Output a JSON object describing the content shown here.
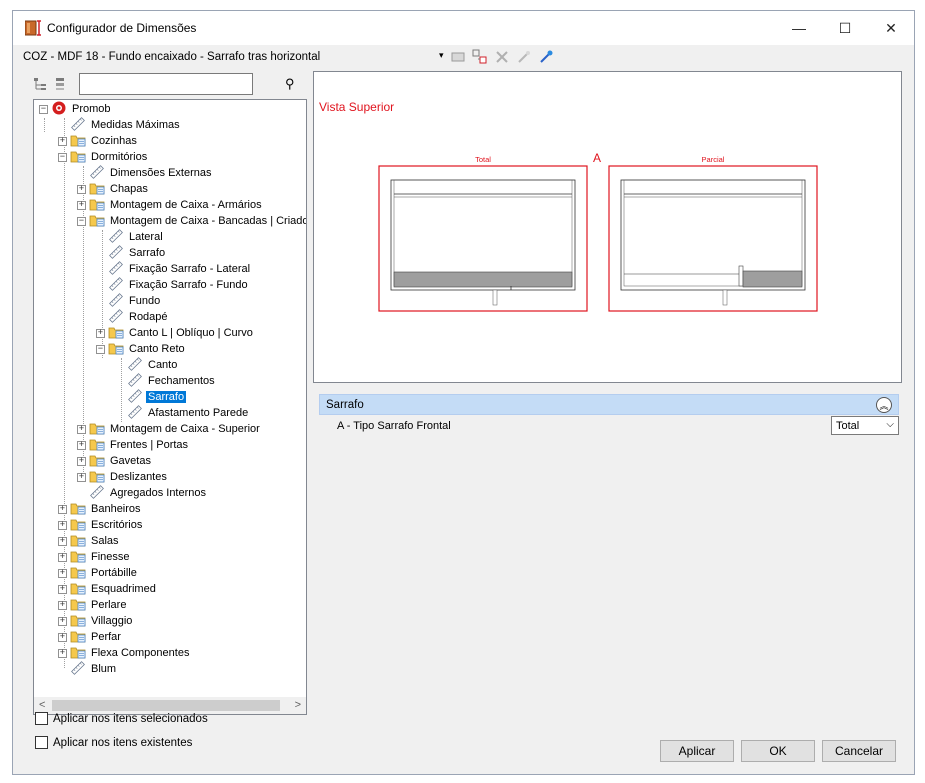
{
  "window": {
    "title": "Configurador de Dimensões",
    "minimize": "—",
    "maximize": "☐",
    "close": "✕"
  },
  "pathbar": {
    "path": "COZ - MDF 18 - Fundo encaixado - Sarrafo tras horizontal",
    "dropdown_glyph": "▾"
  },
  "tree": {
    "nodes": [
      {
        "label": "Promob",
        "depth": 0,
        "expand": "minus",
        "icon": "promob-logo-icon"
      },
      {
        "label": "Medidas Máximas",
        "depth": 1,
        "expand": "none",
        "icon": "ruler-icon"
      },
      {
        "label": "Cozinhas",
        "depth": 1,
        "expand": "plus",
        "icon": "folder-icon"
      },
      {
        "label": "Dormitórios",
        "depth": 1,
        "expand": "minus",
        "icon": "folder-icon"
      },
      {
        "label": "Dimensões Externas",
        "depth": 2,
        "expand": "none",
        "icon": "ruler-icon"
      },
      {
        "label": "Chapas",
        "depth": 2,
        "expand": "plus",
        "icon": "folder-icon"
      },
      {
        "label": "Montagem de Caixa - Armários",
        "depth": 2,
        "expand": "plus",
        "icon": "folder-icon"
      },
      {
        "label": "Montagem de Caixa - Bancadas | Criado",
        "depth": 2,
        "expand": "minus",
        "icon": "folder-icon"
      },
      {
        "label": "Lateral",
        "depth": 3,
        "expand": "none",
        "icon": "ruler-icon"
      },
      {
        "label": "Sarrafo",
        "depth": 3,
        "expand": "none",
        "icon": "ruler-icon"
      },
      {
        "label": "Fixação Sarrafo - Lateral",
        "depth": 3,
        "expand": "none",
        "icon": "ruler-icon"
      },
      {
        "label": "Fixação Sarrafo - Fundo",
        "depth": 3,
        "expand": "none",
        "icon": "ruler-icon"
      },
      {
        "label": "Fundo",
        "depth": 3,
        "expand": "none",
        "icon": "ruler-icon"
      },
      {
        "label": "Rodapé",
        "depth": 3,
        "expand": "none",
        "icon": "ruler-icon"
      },
      {
        "label": "Canto L | Oblíquo | Curvo",
        "depth": 3,
        "expand": "plus",
        "icon": "folder-icon"
      },
      {
        "label": "Canto Reto",
        "depth": 3,
        "expand": "minus",
        "icon": "folder-icon"
      },
      {
        "label": "Canto",
        "depth": 4,
        "expand": "none",
        "icon": "ruler-icon"
      },
      {
        "label": "Fechamentos",
        "depth": 4,
        "expand": "none",
        "icon": "ruler-icon"
      },
      {
        "label": "Sarrafo",
        "depth": 4,
        "expand": "none",
        "icon": "ruler-icon",
        "selected": true
      },
      {
        "label": "Afastamento Parede",
        "depth": 4,
        "expand": "none",
        "icon": "ruler-icon"
      },
      {
        "label": "Montagem de Caixa - Superior",
        "depth": 2,
        "expand": "plus",
        "icon": "folder-icon"
      },
      {
        "label": "Frentes | Portas",
        "depth": 2,
        "expand": "plus",
        "icon": "folder-icon"
      },
      {
        "label": "Gavetas",
        "depth": 2,
        "expand": "plus",
        "icon": "folder-icon"
      },
      {
        "label": "Deslizantes",
        "depth": 2,
        "expand": "plus",
        "icon": "folder-icon"
      },
      {
        "label": "Agregados Internos",
        "depth": 2,
        "expand": "none",
        "icon": "ruler-icon"
      },
      {
        "label": "Banheiros",
        "depth": 1,
        "expand": "plus",
        "icon": "folder-icon"
      },
      {
        "label": "Escritórios",
        "depth": 1,
        "expand": "plus",
        "icon": "folder-icon"
      },
      {
        "label": "Salas",
        "depth": 1,
        "expand": "plus",
        "icon": "folder-icon"
      },
      {
        "label": "Finesse",
        "depth": 1,
        "expand": "plus",
        "icon": "folder-icon"
      },
      {
        "label": "Portábille",
        "depth": 1,
        "expand": "plus",
        "icon": "folder-icon"
      },
      {
        "label": "Esquadrimed",
        "depth": 1,
        "expand": "plus",
        "icon": "folder-icon"
      },
      {
        "label": "Perlare",
        "depth": 1,
        "expand": "plus",
        "icon": "folder-icon"
      },
      {
        "label": "Villaggio",
        "depth": 1,
        "expand": "plus",
        "icon": "folder-icon"
      },
      {
        "label": "Perfar",
        "depth": 1,
        "expand": "plus",
        "icon": "folder-icon"
      },
      {
        "label": "Flexa Componentes",
        "depth": 1,
        "expand": "plus",
        "icon": "folder-icon"
      },
      {
        "label": "Blum",
        "depth": 1,
        "expand": "none",
        "icon": "ruler-icon"
      }
    ]
  },
  "preview": {
    "view_title": "Vista Superior",
    "marker": "A",
    "label_total": "Total",
    "label_partial": "Parcial",
    "accent": "#e0141e"
  },
  "props": {
    "group": "Sarrafo",
    "row_label": "A - Tipo Sarrafo Frontal",
    "row_value": "Total"
  },
  "options": {
    "apply_selected": "Aplicar nos itens selecionados",
    "apply_existing": "Aplicar nos itens existentes"
  },
  "buttons": {
    "apply": "Aplicar",
    "ok": "OK",
    "cancel": "Cancelar"
  }
}
